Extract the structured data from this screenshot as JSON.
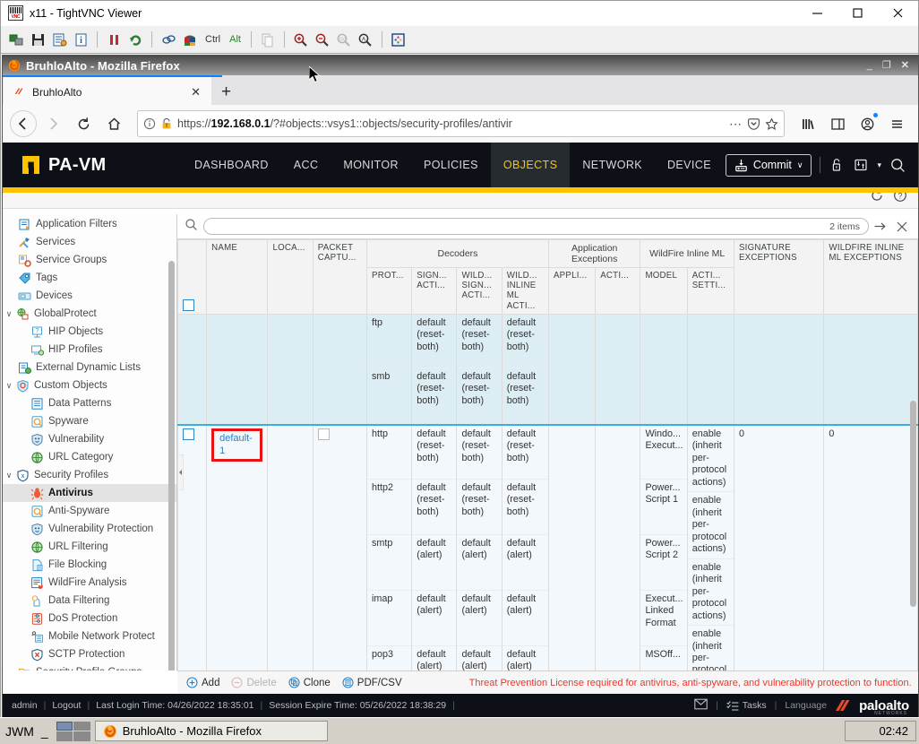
{
  "vnc": {
    "title": "x11 - TightVNC Viewer",
    "toolbar_icons": [
      "new-connection-icon",
      "save-connection-icon",
      "connection-options-icon",
      "connection-info-icon",
      "pause-icon",
      "refresh-icon",
      "send-ctrl-alt-del-icon",
      "send-ctrl-esc-icon",
      "ctrl-key-toggle",
      "alt-key-toggle",
      "transfer-files-icon",
      "zoom-in-icon",
      "zoom-out-icon",
      "zoom-100-icon",
      "zoom-auto-icon",
      "fullscreen-icon"
    ],
    "ctrl_label": "Ctrl",
    "alt_label": "Alt",
    "window_buttons": {
      "minimize": "minimize-icon",
      "maximize": "maximize-icon",
      "close": "close-icon"
    }
  },
  "firefox": {
    "title": "BruhloAlto - Mozilla Firefox",
    "window_buttons": {
      "minimize": "_",
      "restore": "❐",
      "close": "✕"
    },
    "tab": {
      "label": "BruhloAlto",
      "close": "✕"
    },
    "new_tab": "+",
    "nav": {
      "back": "←",
      "forward": "→",
      "reload": "⟳",
      "home": "⌂"
    },
    "url": {
      "prefix": "https://",
      "host": "192.168.0.1",
      "path": "/?#objects::vsys1::objects/security-profiles/antivir",
      "full": "https://192.168.0.1/?#objects::vsys1::objects/security-profiles/antivir"
    },
    "url_icons": [
      "page-info-icon",
      "insecure-warning-icon",
      "page-actions-menu-icon",
      "save-to-pocket-icon",
      "bookmark-star-icon"
    ],
    "right_icons": [
      "library-icon",
      "sidebars-icon",
      "account-icon",
      "hamburger-menu-icon"
    ]
  },
  "panos": {
    "brand": "PA-VM",
    "nav_items": [
      {
        "label": "DASHBOARD",
        "active": false
      },
      {
        "label": "ACC",
        "active": false
      },
      {
        "label": "MONITOR",
        "active": false
      },
      {
        "label": "POLICIES",
        "active": false
      },
      {
        "label": "OBJECTS",
        "active": true
      },
      {
        "label": "NETWORK",
        "active": false
      },
      {
        "label": "DEVICE",
        "active": false
      }
    ],
    "commit_label": "Commit",
    "commit_caret": "∨",
    "header_icons": [
      "unlock-config-icon",
      "config-transfer-icon",
      "search-icon"
    ],
    "subbar_icons": [
      "refresh-icon",
      "help-icon"
    ],
    "sidebar_items": [
      {
        "label": "Application Filters",
        "level": 1,
        "icon": "application-filters-icon",
        "twisty": "",
        "selected": false,
        "dot": false
      },
      {
        "label": "Services",
        "level": 1,
        "icon": "services-icon",
        "twisty": "",
        "selected": false,
        "dot": false
      },
      {
        "label": "Service Groups",
        "level": 1,
        "icon": "service-groups-icon",
        "twisty": "",
        "selected": false,
        "dot": false
      },
      {
        "label": "Tags",
        "level": 1,
        "icon": "tags-icon",
        "twisty": "",
        "selected": false,
        "dot": false
      },
      {
        "label": "Devices",
        "level": 1,
        "icon": "devices-icon",
        "twisty": "",
        "selected": false,
        "dot": false
      },
      {
        "label": "GlobalProtect",
        "level": 0,
        "icon": "globalprotect-icon",
        "twisty": "∨",
        "selected": false,
        "dot": false
      },
      {
        "label": "HIP Objects",
        "level": 2,
        "icon": "hip-objects-icon",
        "twisty": "",
        "selected": false,
        "dot": false
      },
      {
        "label": "HIP Profiles",
        "level": 2,
        "icon": "hip-profiles-icon",
        "twisty": "",
        "selected": false,
        "dot": false
      },
      {
        "label": "External Dynamic Lists",
        "level": 1,
        "icon": "external-dynamic-lists-icon",
        "twisty": "",
        "selected": false,
        "dot": false
      },
      {
        "label": "Custom Objects",
        "level": 0,
        "icon": "custom-objects-icon",
        "twisty": "∨",
        "selected": false,
        "dot": false
      },
      {
        "label": "Data Patterns",
        "level": 2,
        "icon": "data-patterns-icon",
        "twisty": "",
        "selected": false,
        "dot": false
      },
      {
        "label": "Spyware",
        "level": 2,
        "icon": "spyware-icon",
        "twisty": "",
        "selected": false,
        "dot": false
      },
      {
        "label": "Vulnerability",
        "level": 2,
        "icon": "vulnerability-icon",
        "twisty": "",
        "selected": false,
        "dot": false
      },
      {
        "label": "URL Category",
        "level": 2,
        "icon": "url-category-icon",
        "twisty": "",
        "selected": false,
        "dot": false
      },
      {
        "label": "Security Profiles",
        "level": 0,
        "icon": "security-profiles-icon",
        "twisty": "∨",
        "selected": false,
        "dot": false
      },
      {
        "label": "Antivirus",
        "level": 2,
        "icon": "antivirus-icon",
        "twisty": "",
        "selected": true,
        "dot": true
      },
      {
        "label": "Anti-Spyware",
        "level": 2,
        "icon": "anti-spyware-icon",
        "twisty": "",
        "selected": false,
        "dot": false
      },
      {
        "label": "Vulnerability Protection",
        "level": 2,
        "icon": "vulnerability-protection-icon",
        "twisty": "",
        "selected": false,
        "dot": false
      },
      {
        "label": "URL Filtering",
        "level": 2,
        "icon": "url-filtering-icon",
        "twisty": "",
        "selected": false,
        "dot": false
      },
      {
        "label": "File Blocking",
        "level": 2,
        "icon": "file-blocking-icon",
        "twisty": "",
        "selected": false,
        "dot": false
      },
      {
        "label": "WildFire Analysis",
        "level": 2,
        "icon": "wildfire-analysis-icon",
        "twisty": "",
        "selected": false,
        "dot": false
      },
      {
        "label": "Data Filtering",
        "level": 2,
        "icon": "data-filtering-icon",
        "twisty": "",
        "selected": false,
        "dot": false
      },
      {
        "label": "DoS Protection",
        "level": 2,
        "icon": "dos-protection-icon",
        "twisty": "",
        "selected": false,
        "dot": true
      },
      {
        "label": "Mobile Network Protect",
        "level": 2,
        "icon": "mobile-network-protection-icon",
        "twisty": "",
        "selected": false,
        "dot": false
      },
      {
        "label": "SCTP Protection",
        "level": 2,
        "icon": "sctp-protection-icon",
        "twisty": "",
        "selected": false,
        "dot": false
      },
      {
        "label": "Security Profile Groups",
        "level": 1,
        "icon": "security-profile-groups-icon",
        "twisty": "",
        "selected": false,
        "dot": false
      }
    ],
    "search": {
      "value": "",
      "placeholder": "",
      "items_count": "2 items",
      "apply_icon": "apply-filter-icon",
      "clear_icon": "clear-filter-icon"
    },
    "table": {
      "group_headers": [
        {
          "label": "Decoders",
          "span": 4
        },
        {
          "label": "Application Exceptions",
          "span": 2
        },
        {
          "label": "WildFire Inline ML",
          "span": 2
        }
      ],
      "columns": [
        "",
        "NAME",
        "LOCA...",
        "PACKET CAPTU...",
        "PROT...",
        "SIGN... ACTI...",
        "WILD... SIGN... ACTI...",
        "WILD... INLINE ML ACTI...",
        "APPLI...",
        "ACTI...",
        "MODEL",
        "ACTI... SETTI...",
        "SIGNATURE EXCEPTIONS",
        "WILDFIRE INLINE ML EXCEPTIONS"
      ],
      "rows": [
        {
          "selected": false,
          "partial": true,
          "name": "",
          "location": "",
          "packet_capture": null,
          "decoders": [
            {
              "protocol": "ftp",
              "signature_action": "default (reset-both)",
              "wildfire_signature_action": "default (reset-both)",
              "wildfire_inline_ml_action": "default (reset-both)"
            },
            {
              "protocol": "smb",
              "signature_action": "default (reset-both)",
              "wildfire_signature_action": "default (reset-both)",
              "wildfire_inline_ml_action": "default (reset-both)"
            }
          ],
          "app_exceptions": [],
          "wildfire_models": [],
          "signature_exceptions": "",
          "wildfire_inline_ml_exceptions": ""
        },
        {
          "selected": true,
          "partial": false,
          "name": "default-1",
          "name_highlighted": true,
          "location": "",
          "packet_capture": false,
          "decoders": [
            {
              "protocol": "http",
              "signature_action": "default (reset-both)",
              "wildfire_signature_action": "default (reset-both)",
              "wildfire_inline_ml_action": "default (reset-both)"
            },
            {
              "protocol": "http2",
              "signature_action": "default (reset-both)",
              "wildfire_signature_action": "default (reset-both)",
              "wildfire_inline_ml_action": "default (reset-both)"
            },
            {
              "protocol": "smtp",
              "signature_action": "default (alert)",
              "wildfire_signature_action": "default (alert)",
              "wildfire_inline_ml_action": "default (alert)"
            },
            {
              "protocol": "imap",
              "signature_action": "default (alert)",
              "wildfire_signature_action": "default (alert)",
              "wildfire_inline_ml_action": "default (alert)"
            },
            {
              "protocol": "pop3",
              "signature_action": "default (alert)",
              "wildfire_signature_action": "default (alert)",
              "wildfire_inline_ml_action": "default (alert)"
            }
          ],
          "app_exceptions": [],
          "wildfire_models": [
            {
              "model": "Windo... Execut...",
              "action_setting": "enable (inherit per-protocol actions)"
            },
            {
              "model": "Power... Script 1",
              "action_setting": "enable (inherit per-protocol actions)"
            },
            {
              "model": "Power... Script 2",
              "action_setting": "enable (inherit per-protocol actions)"
            },
            {
              "model": "Execut... Linked Format",
              "action_setting": "enable (inherit per-protocol actions)"
            },
            {
              "model": "MSOff...",
              "action_setting": "enable (inherit"
            }
          ],
          "signature_exceptions": "0",
          "wildfire_inline_ml_exceptions": "0"
        }
      ]
    },
    "footer": {
      "add": "Add",
      "delete": "Delete",
      "clone": "Clone",
      "pdf_csv": "PDF/CSV",
      "license_warning": "Threat Prevention License required for antivirus, anti-spyware, and vulnerability protection to function."
    },
    "statusbar": {
      "user": "admin",
      "logout": "Logout",
      "last_login": "Last Login Time: 04/26/2022 18:35:01",
      "session_expire": "Session Expire Time: 05/26/2022 18:38:29",
      "tasks": "Tasks",
      "language": "Language",
      "brand": "paloalto",
      "brand_sub": "NETWORKS",
      "icons": [
        "email-alerts-icon",
        "tasks-icon"
      ]
    }
  },
  "taskbar": {
    "wm_label": "JWM",
    "minimize_label": "_",
    "task_label": "BruhloAlto - Mozilla Firefox",
    "clock": "02:42"
  },
  "colors": {
    "pan_accent": "#fdc300",
    "pan_header_bg": "#0d1117",
    "highlight_red": "#e81414",
    "link_blue": "#2a7fc1",
    "row_prev": "#dcedf4",
    "row_sel": "#f3f8fd",
    "warning_red": "#e8392e",
    "firefox_tab_accent": "#0a84ff"
  }
}
